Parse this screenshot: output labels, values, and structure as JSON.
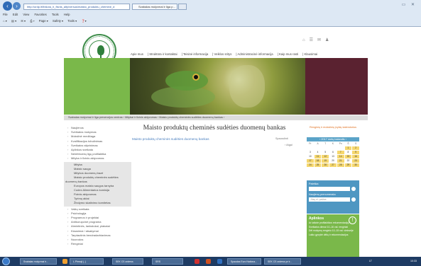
{
  "browser": {
    "address": "http://ordp.lt/lt/sluta_ir_fisnis_alty/versus/maisto_produktu_chemine_d",
    "tab_active": "Svabalas molyvmai ir liga p...",
    "tab_new": "",
    "menu": [
      "File",
      "Edit",
      "View",
      "Favorites",
      "Tools",
      "Help"
    ],
    "commands": [
      "Page ▾",
      "Safety ▾",
      "Tools ▾"
    ]
  },
  "site": {
    "top_nav": [
      "Apie mus",
      "Struktūra ir kontaktai",
      "Teisinė informacija",
      "Veiklos sritys",
      "Administracinė informacija",
      "Kaip mus rasti",
      "Klausimai"
    ],
    "breadcrumb": "Svabalas molyvmai ir liga prevencijos centras  ›  Mitybai ir fizinis aktyvumas  ›  Maisto produktų cheminės sudėties duomenų bankas  ›",
    "left_nav_top": [
      "Naujienos",
      "Sveikatos mokymas",
      "Mokslinė medžiaga",
      "Kvalifikacijos tobulinimas",
      "Sveikatos stiprinimas",
      "Aplinkos sveikata",
      "Neinfekcinių ligų profilaktika",
      "Mityba ir fizinis aktyvumas"
    ],
    "left_nav_sub": [
      "Mityba",
      "Maisto sauga",
      "Mitybos duomenų bazė",
      "Maisto produktų cheminės sudėties"
    ],
    "left_nav_sub_flat": "duomenų bankas",
    "left_nav_sub2": [
      "Europos maisto saugos tarnyba",
      "Codex Alimentarius komisija",
      "Fizinis aktyvumas",
      "Tyrimų aktai",
      "Žindymo skatinimo komitetas"
    ],
    "left_nav_bottom": [
      "Vaikų sveikata",
      "Psichologija",
      "Programos ir projektai",
      "Antikorupcinė programa",
      "Atmintinės, lankstukai, plakatai",
      "Klausimai / atsakymai",
      "Tarptautinis bendradarbiavimas",
      "Nuorodos",
      "Renginiai"
    ],
    "page_title": "Maisto produktų cheminės sudėties duomenų bankas",
    "content_link": "Maisto produktų cheminės sudėties duomenų bankas",
    "print": "Spausdinti",
    "back": "‹ Atgal",
    "promo": "Renginių ir mokslinių įvykių kalendorius",
    "calendar": {
      "month": "2017 metų balandis",
      "weekdays": [
        "Pr",
        "A",
        "T",
        "K",
        "Pn",
        "Š",
        "S"
      ],
      "days": [
        "",
        "",
        "",
        "",
        "",
        "1",
        "2",
        "3",
        "4",
        "5",
        "6",
        "7",
        "8",
        "9",
        "10",
        "11",
        "12",
        "13",
        "14",
        "15",
        "16",
        "17",
        "18",
        "19",
        "20",
        "21",
        "22",
        "23",
        "24",
        "25",
        "26",
        "27",
        "28",
        "29",
        "30"
      ],
      "events": [
        "1",
        "2",
        "7",
        "9",
        "11",
        "12",
        "14",
        "15",
        "16",
        "17",
        "18",
        "19",
        "21",
        "23",
        "24",
        "25",
        "26",
        "27",
        "28",
        "29",
        "30"
      ]
    },
    "search_label": "Paieška",
    "search_placeholder": "",
    "subscribe_label": "Naujienų prenumerata",
    "subscribe_placeholder": "Jūsų el. paštas",
    "news_title": "Aplinkos",
    "news_items": [
      "Ar laikote profilaktikos rekomendacijų?",
      "Sveikatos dienai 10–16 val. renginiai",
      "Dėl mokymų renginio 10–15 val. vietovėje",
      "Laiko gyvybė dėlių ir rekomendacijos"
    ]
  },
  "taskbar": {
    "items": [
      "Svabalas molyvmai ir...",
      "L.Pirmoji (..)",
      "SEK CS orderss",
      "SRS",
      "Spaudas Euro Nationa...",
      "SEK CS orderss pr ir..."
    ],
    "clock": "10:33",
    "tray": "LT"
  }
}
